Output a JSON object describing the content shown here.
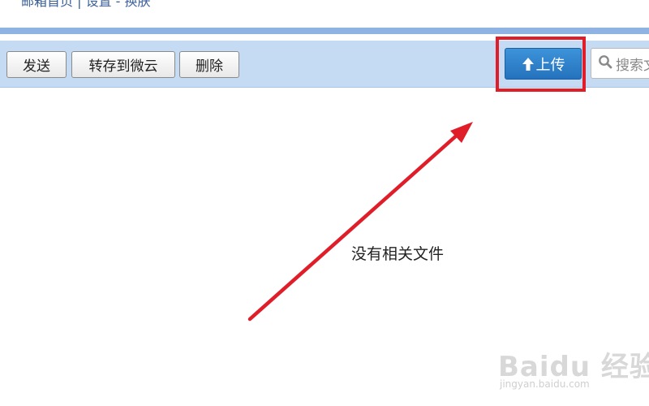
{
  "breadcrumb": {
    "text": "邮箱首页 | 设置 - 换肤"
  },
  "toolbar": {
    "send_label": "发送",
    "save_to_weiyun_label": "转存到微云",
    "delete_label": "删除",
    "upload_label": "上传",
    "search_placeholder": "搜索文"
  },
  "main": {
    "empty_message": "没有相关文件"
  },
  "annotation": {
    "highlight_color": "#e01e2a",
    "arrow_color": "#e01e2a"
  },
  "watermark": {
    "brand": "Baidu 经验",
    "url": "jingyan.baidu.com"
  },
  "colors": {
    "toolbar_bg": "#c5dbf3",
    "upload_button": "#2f83cc",
    "top_band": "#8fb3e3"
  }
}
